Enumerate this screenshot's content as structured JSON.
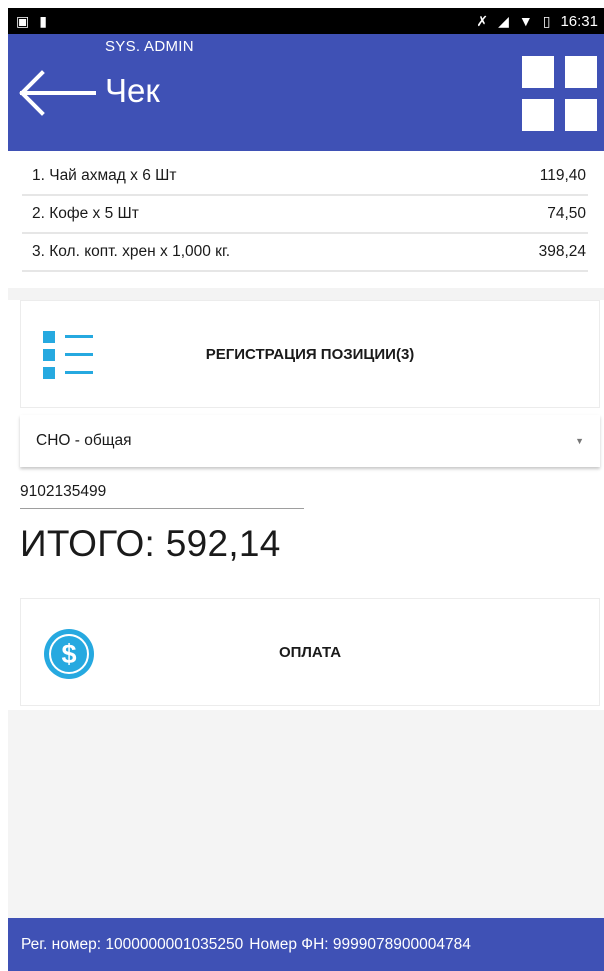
{
  "status_bar": {
    "left_icons": [
      "image-icon",
      "sd-card-icon"
    ],
    "right_icons": [
      "bluetooth-off-icon",
      "signal-off-icon",
      "wifi-icon",
      "battery-icon"
    ],
    "time": "16:31"
  },
  "header": {
    "user": "SYS. ADMIN",
    "title": "Чек",
    "back_icon": "arrow-left-icon",
    "menu_icon": "grid-icon"
  },
  "items": [
    {
      "name": "1. Чай ахмад х 6 Шт",
      "amount": "119,40"
    },
    {
      "name": "2. Кофе х 5 Шт",
      "amount": "74,50"
    },
    {
      "name": "3. Кол. копт. хрен х 1,000 кг.",
      "amount": "398,24"
    }
  ],
  "register_card": {
    "icon": "list-icon",
    "label": "РЕГИСТРАЦИЯ ПОЗИЦИИ(3)"
  },
  "tax_select": {
    "value": "СНО - общая"
  },
  "phone_field": {
    "value": "9102135499"
  },
  "total": {
    "text": "ИТОГО: 592,14"
  },
  "payment_card": {
    "icon": "dollar-icon",
    "label": "ОПЛАТА"
  },
  "footer": {
    "reg_number": "Рег. номер: 1000000001035250",
    "fn_number": "Номер ФН: 9999078900004784"
  },
  "colors": {
    "primary": "#3f51b5",
    "accent": "#26a9e0"
  }
}
